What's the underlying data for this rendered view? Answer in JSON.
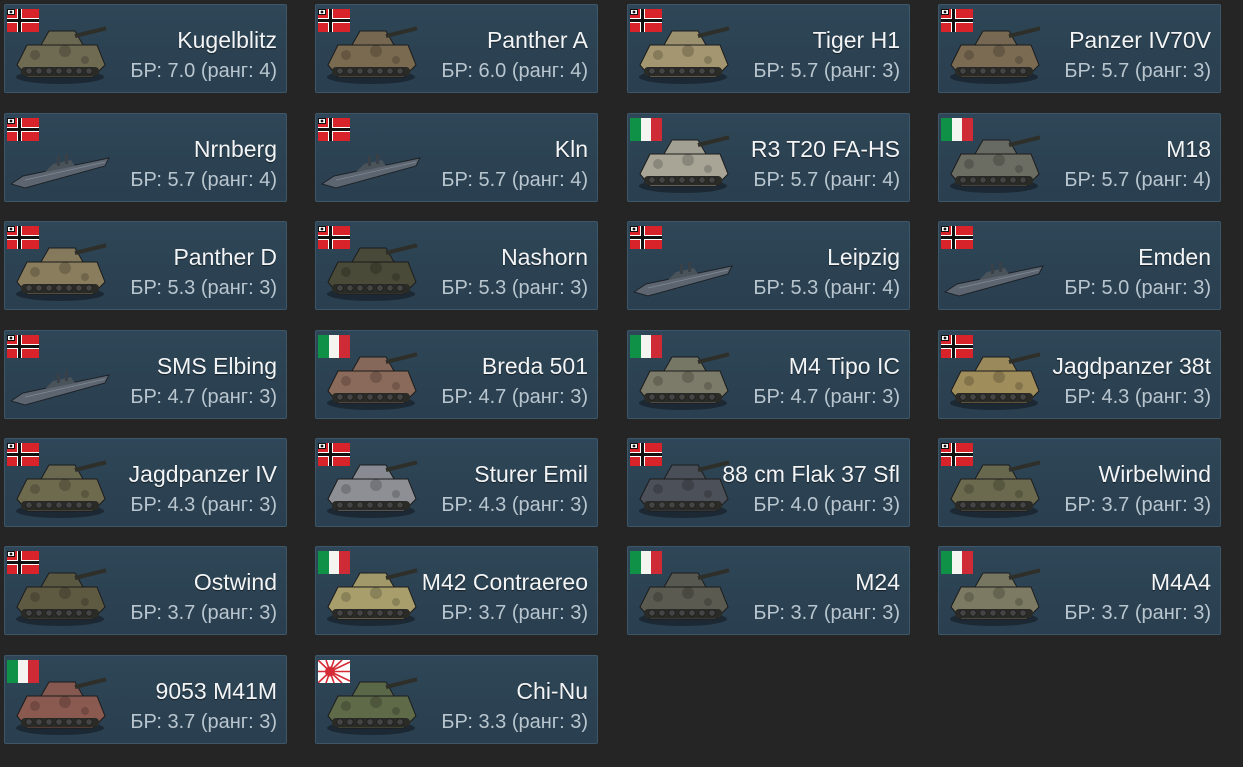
{
  "br_prefix": "БР:",
  "rank_word": "ранг:",
  "vehicles": [
    {
      "name": "Kugelblitz",
      "br": "7.0",
      "rank": "4",
      "nation": "germany",
      "kind": "tank",
      "color": "#6f6a52"
    },
    {
      "name": "Panther A",
      "br": "6.0",
      "rank": "4",
      "nation": "germany",
      "kind": "tank",
      "color": "#7a6a50"
    },
    {
      "name": "Tiger H1",
      "br": "5.7",
      "rank": "3",
      "nation": "germany",
      "kind": "tank",
      "color": "#a39670"
    },
    {
      "name": "Panzer IV70V",
      "br": "5.7",
      "rank": "3",
      "nation": "germany",
      "kind": "tank",
      "color": "#7b6b52"
    },
    {
      "name": "Nrnberg",
      "br": "5.7",
      "rank": "4",
      "nation": "germany",
      "kind": "ship",
      "color": "#5d6670"
    },
    {
      "name": "Kln",
      "br": "5.7",
      "rank": "4",
      "nation": "germany",
      "kind": "ship",
      "color": "#5d6670"
    },
    {
      "name": "R3 T20 FA-HS",
      "br": "5.7",
      "rank": "4",
      "nation": "italy",
      "kind": "tank",
      "color": "#a8a596"
    },
    {
      "name": "M18",
      "br": "5.7",
      "rank": "4",
      "nation": "italy",
      "kind": "tank",
      "color": "#6b6d63"
    },
    {
      "name": "Panther D",
      "br": "5.3",
      "rank": "3",
      "nation": "germany",
      "kind": "tank",
      "color": "#8a7d5d"
    },
    {
      "name": "Nashorn",
      "br": "5.3",
      "rank": "3",
      "nation": "germany",
      "kind": "tank",
      "color": "#4a4a38"
    },
    {
      "name": "Leipzig",
      "br": "5.3",
      "rank": "4",
      "nation": "germany",
      "kind": "ship",
      "color": "#5d6670"
    },
    {
      "name": "Emden",
      "br": "5.0",
      "rank": "3",
      "nation": "germany",
      "kind": "ship",
      "color": "#5d6670"
    },
    {
      "name": "SMS Elbing",
      "br": "4.7",
      "rank": "3",
      "nation": "germany",
      "kind": "ship",
      "color": "#5d6670"
    },
    {
      "name": "Breda 501",
      "br": "4.7",
      "rank": "3",
      "nation": "italy",
      "kind": "tank",
      "color": "#8a6a5a"
    },
    {
      "name": "M4 Tipo IC",
      "br": "4.7",
      "rank": "3",
      "nation": "italy",
      "kind": "tank",
      "color": "#7c7a68"
    },
    {
      "name": "Jagdpanzer 38t",
      "br": "4.3",
      "rank": "3",
      "nation": "germany",
      "kind": "tank",
      "color": "#a08d5c"
    },
    {
      "name": "Jagdpanzer IV",
      "br": "4.3",
      "rank": "3",
      "nation": "germany",
      "kind": "tank",
      "color": "#6e6a4e"
    },
    {
      "name": "Sturer Emil",
      "br": "4.3",
      "rank": "3",
      "nation": "germany",
      "kind": "tank",
      "color": "#8d8f95"
    },
    {
      "name": "88 cm Flak 37 Sfl",
      "br": "4.0",
      "rank": "3",
      "nation": "germany",
      "kind": "tank",
      "color": "#4c5058"
    },
    {
      "name": "Wirbelwind",
      "br": "3.7",
      "rank": "3",
      "nation": "germany",
      "kind": "tank",
      "color": "#6b6a4e"
    },
    {
      "name": "Ostwind",
      "br": "3.7",
      "rank": "3",
      "nation": "germany",
      "kind": "tank",
      "color": "#5e5a42"
    },
    {
      "name": "M42 Contraereo",
      "br": "3.7",
      "rank": "3",
      "nation": "italy",
      "kind": "tank",
      "color": "#a89e6c"
    },
    {
      "name": "M24",
      "br": "3.7",
      "rank": "3",
      "nation": "italy",
      "kind": "tank",
      "color": "#5a5a50"
    },
    {
      "name": "M4A4",
      "br": "3.7",
      "rank": "3",
      "nation": "italy",
      "kind": "tank",
      "color": "#7c7a62"
    },
    {
      "name": "9053 M41M",
      "br": "3.7",
      "rank": "3",
      "nation": "italy",
      "kind": "tank",
      "color": "#8a5a50"
    },
    {
      "name": "Chi-Nu",
      "br": "3.3",
      "rank": "3",
      "nation": "japan",
      "kind": "tank",
      "color": "#5e6a48"
    }
  ]
}
